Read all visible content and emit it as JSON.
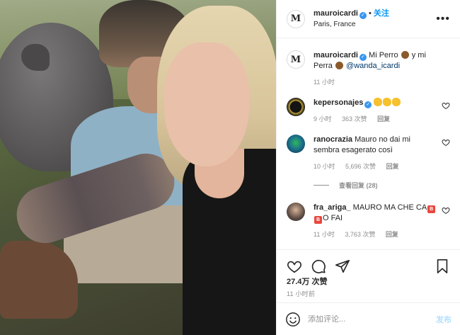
{
  "post": {
    "author": {
      "username": "mauroicardi",
      "verified": true,
      "avatar_monogram": "M",
      "location": "Paris, France"
    },
    "header": {
      "separator": "•",
      "follow_label": "关注",
      "more_icon": "more-horizontal-icon"
    },
    "caption": {
      "username": "mauroicardi",
      "text_part1": "Mi Perro",
      "text_part2": "y mi Perra",
      "mention": "@wanda_icardi",
      "time": "11 小时"
    },
    "comments": [
      {
        "username": "kepersonajes",
        "verified": true,
        "emoji_count": 3,
        "time": "9 小时",
        "likes": "363 次赞",
        "reply_label": "回复"
      },
      {
        "username": "ranocrazia",
        "text": "Mauro no dai mi sembra esagerato così",
        "time": "10 小时",
        "likes": "5,696 次赞",
        "reply_label": "回复",
        "view_replies": "查看回复 (28)"
      },
      {
        "username": "fra_ariga_",
        "text_before": "MAURO MA CHE CA",
        "badges": [
          "B",
          "B"
        ],
        "text_after": "O FAI",
        "time": "11 小时",
        "likes": "3,763 次赞",
        "reply_label": "回复"
      }
    ],
    "actions": {
      "like_icon": "heart-icon",
      "comment_icon": "comment-icon",
      "share_icon": "send-icon",
      "save_icon": "bookmark-icon"
    },
    "likes_count": "27.4万 次赞",
    "posted_ago": "11 小时前",
    "add_comment": {
      "placeholder": "添加评论...",
      "post_label": "发布",
      "emoji_icon": "smile-icon"
    }
  },
  "colors": {
    "accent": "#0095f6",
    "post_disabled": "#b2dffc",
    "verified": "#3897f0",
    "muted": "#8e8e8e",
    "text": "#262626"
  }
}
